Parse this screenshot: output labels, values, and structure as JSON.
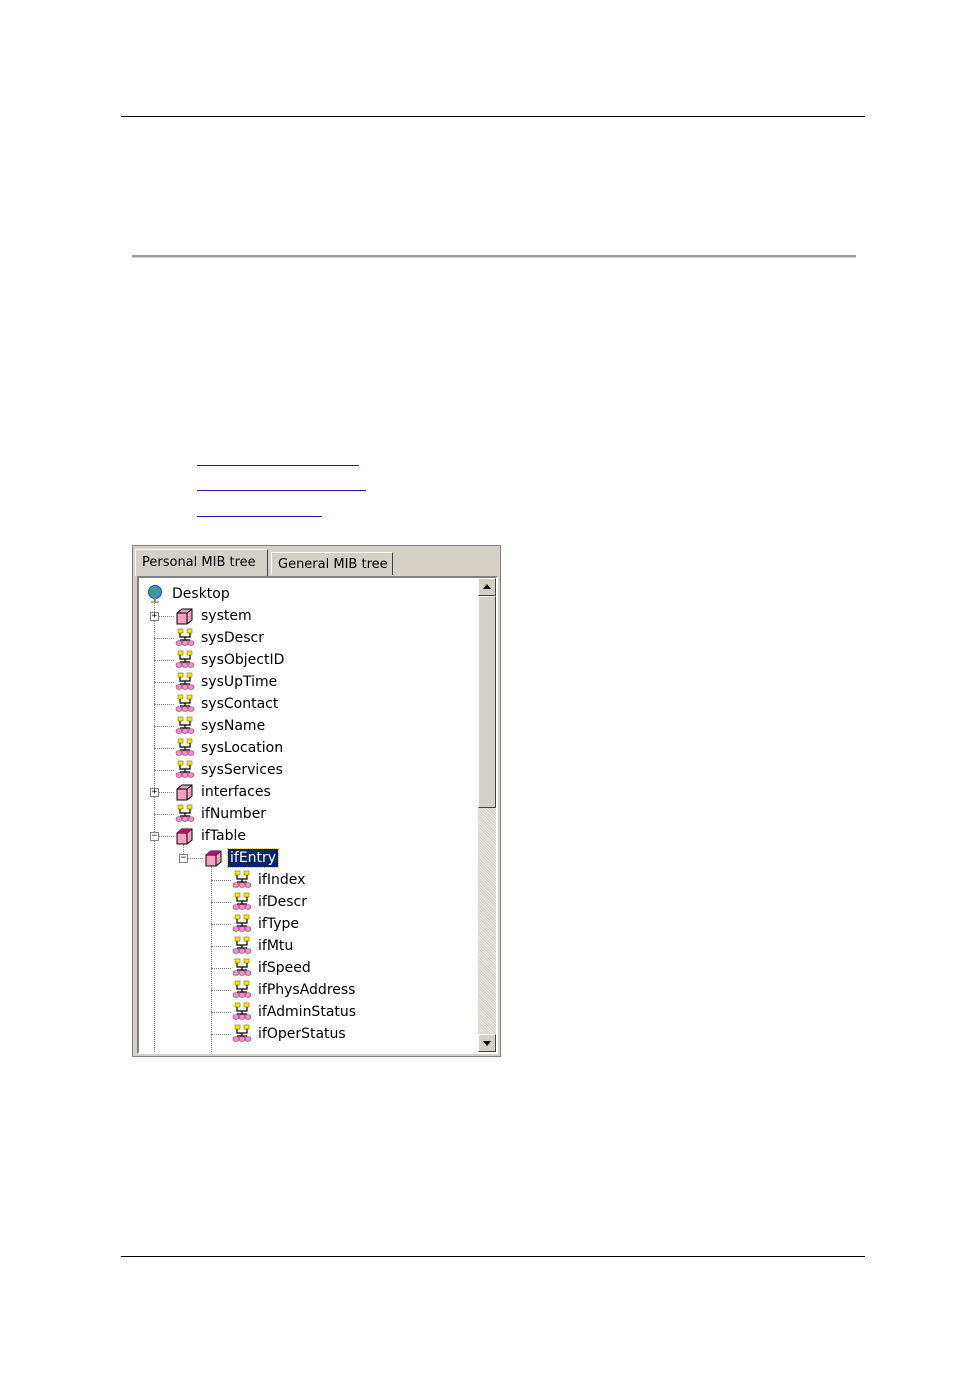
{
  "tabs": [
    {
      "label": "Personal MIB tree",
      "active": true
    },
    {
      "label": "General MIB tree",
      "active": false
    }
  ],
  "tree": {
    "root": {
      "label": "Desktop",
      "icon": "globe-icon"
    },
    "nodes": [
      {
        "label": "system",
        "icon": "folder-box-icon",
        "expander": "+"
      },
      {
        "label": "sysDescr",
        "icon": "mib-leaf-icon"
      },
      {
        "label": "sysObjectID",
        "icon": "mib-leaf-icon"
      },
      {
        "label": "sysUpTime",
        "icon": "mib-leaf-icon"
      },
      {
        "label": "sysContact",
        "icon": "mib-leaf-icon"
      },
      {
        "label": "sysName",
        "icon": "mib-leaf-icon"
      },
      {
        "label": "sysLocation",
        "icon": "mib-leaf-icon"
      },
      {
        "label": "sysServices",
        "icon": "mib-leaf-icon"
      },
      {
        "label": "interfaces",
        "icon": "folder-box-icon",
        "expander": "+"
      },
      {
        "label": "ifNumber",
        "icon": "mib-leaf-icon"
      },
      {
        "label": "ifTable",
        "icon": "open-box-icon",
        "expander": "−"
      },
      {
        "label": "ifEntry",
        "icon": "open-box-icon",
        "expander": "−",
        "selected": true
      },
      {
        "label": "ifIndex",
        "icon": "mib-leaf-icon"
      },
      {
        "label": "ifDescr",
        "icon": "mib-leaf-icon"
      },
      {
        "label": "ifType",
        "icon": "mib-leaf-icon"
      },
      {
        "label": "ifMtu",
        "icon": "mib-leaf-icon"
      },
      {
        "label": "ifSpeed",
        "icon": "mib-leaf-icon"
      },
      {
        "label": "ifPhysAddress",
        "icon": "mib-leaf-icon"
      },
      {
        "label": "ifAdminStatus",
        "icon": "mib-leaf-icon"
      },
      {
        "label": "ifOperStatus",
        "icon": "mib-leaf-icon"
      }
    ]
  },
  "colors": {
    "box": "#f4a0c0",
    "selection": "#0a246a",
    "link": "#1a1aa8"
  }
}
